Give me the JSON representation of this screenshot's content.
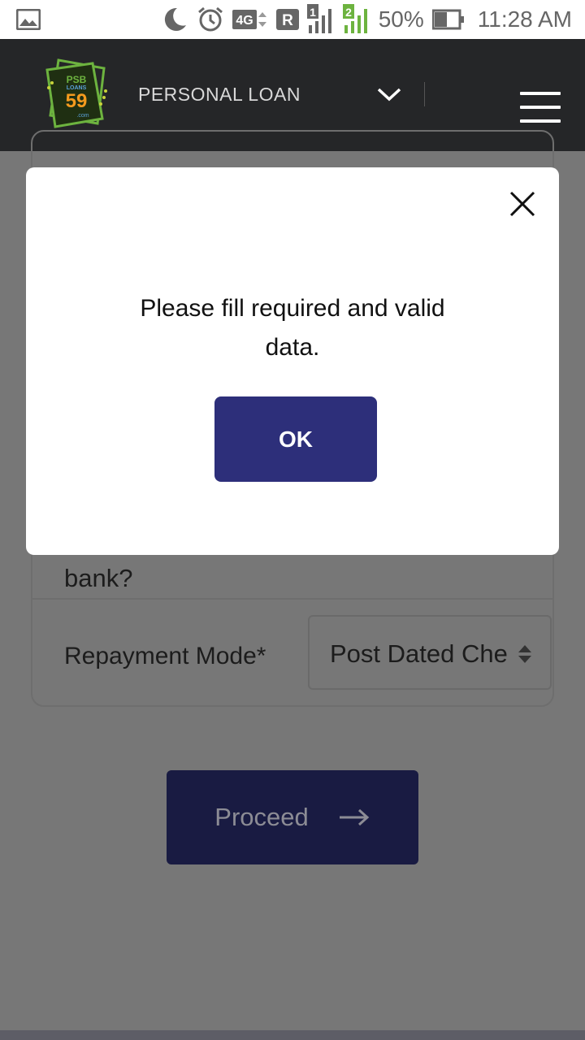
{
  "status_bar": {
    "network": "4G",
    "roaming": "R",
    "sim1": "1",
    "sim2": "2",
    "battery_percent": "50%",
    "time": "11:28 AM"
  },
  "header": {
    "logo": {
      "line1": "PSB",
      "line2": "LOANS",
      "number": "59",
      "suffix": ".com"
    },
    "product_label": "PERSONAL LOAN"
  },
  "form": {
    "bank_question_tail": "bank?",
    "repayment_label": "Repayment Mode*",
    "repayment_value": "Post Dated Cheque"
  },
  "proceed_label": "Proceed",
  "modal": {
    "message": "Please fill required and valid data.",
    "ok_label": "OK"
  },
  "colors": {
    "header_bg": "#252628",
    "overlay_bg": "#777777",
    "primary_button": "#2d2f7a",
    "proceed_button": "#191b42"
  }
}
